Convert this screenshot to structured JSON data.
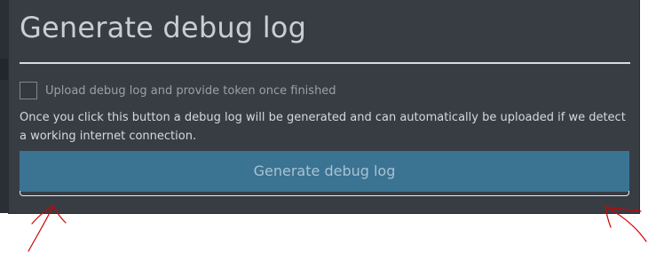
{
  "dialog": {
    "title": "Generate debug log",
    "upload_checkbox": {
      "label": "Upload debug log and provide token once finished",
      "checked": false
    },
    "description": "Once you click this button a debug log will be generated and can automatically be uploaded if we detect a working internet connection.",
    "generate_button_label": "Generate debug log"
  },
  "colors": {
    "dialog_background": "#383d44",
    "button_background": "#3b7392",
    "annotation_arrows": "#d40000"
  },
  "icons": {
    "annotations": [
      "arrow-left-icon",
      "arrow-right-icon"
    ]
  }
}
